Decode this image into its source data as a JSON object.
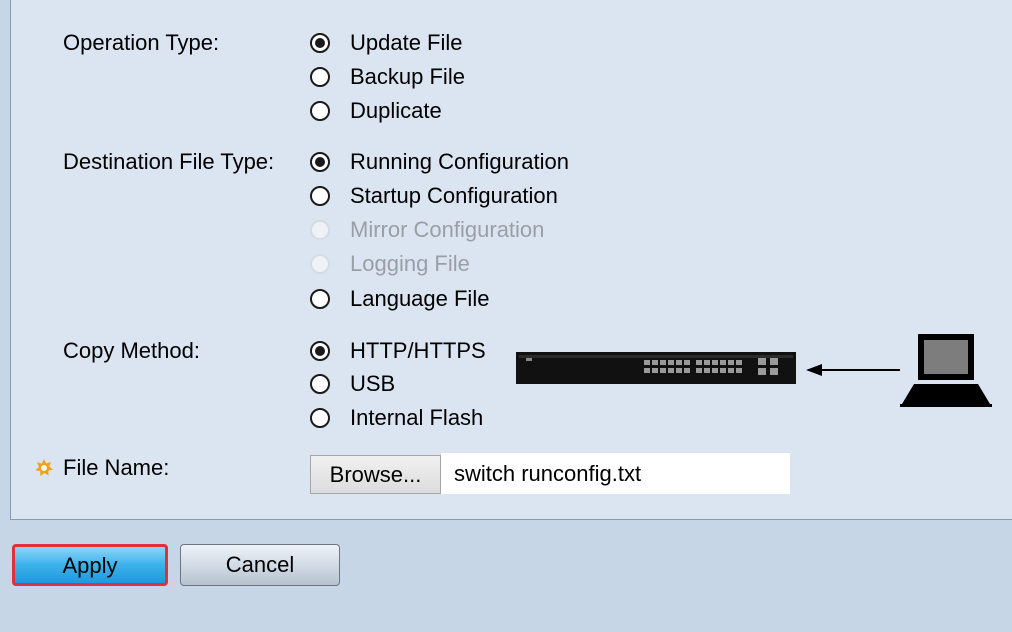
{
  "operation_type": {
    "label": "Operation Type:",
    "options": [
      {
        "label": "Update File",
        "checked": true,
        "disabled": false
      },
      {
        "label": "Backup File",
        "checked": false,
        "disabled": false
      },
      {
        "label": "Duplicate",
        "checked": false,
        "disabled": false
      }
    ]
  },
  "destination_file_type": {
    "label": "Destination File Type:",
    "options": [
      {
        "label": "Running Configuration",
        "checked": true,
        "disabled": false
      },
      {
        "label": "Startup Configuration",
        "checked": false,
        "disabled": false
      },
      {
        "label": "Mirror Configuration",
        "checked": false,
        "disabled": true
      },
      {
        "label": "Logging File",
        "checked": false,
        "disabled": true
      },
      {
        "label": "Language File",
        "checked": false,
        "disabled": false
      }
    ]
  },
  "copy_method": {
    "label": "Copy Method:",
    "options": [
      {
        "label": "HTTP/HTTPS",
        "checked": true,
        "disabled": false
      },
      {
        "label": "USB",
        "checked": false,
        "disabled": false
      },
      {
        "label": "Internal Flash",
        "checked": false,
        "disabled": false
      }
    ]
  },
  "file_name": {
    "label": "File Name:",
    "required_icon": "required-star-icon",
    "browse_label": "Browse...",
    "value": "switch runconfig.txt"
  },
  "buttons": {
    "apply": "Apply",
    "cancel": "Cancel"
  },
  "colors": {
    "background": "#c6d6e7",
    "panel": "#dbe5f1",
    "apply_highlight": "#e0303a"
  }
}
